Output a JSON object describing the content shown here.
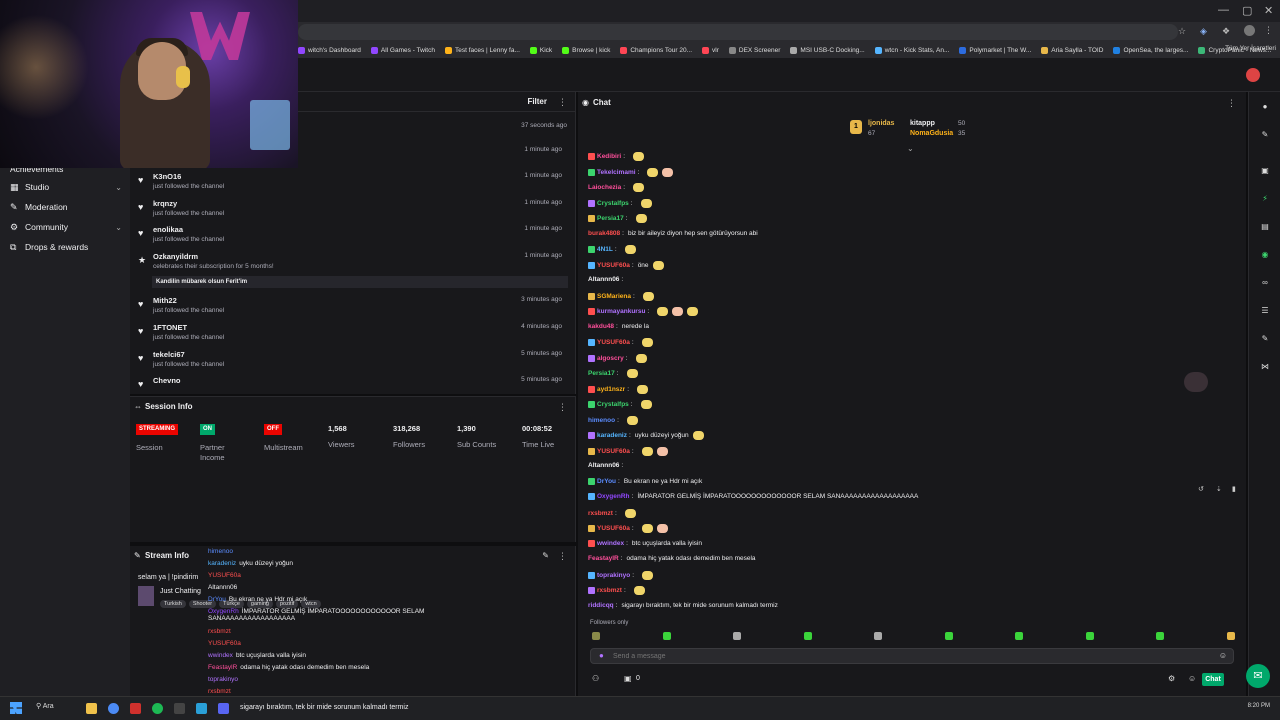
{
  "browser": {
    "bookmarks": [
      "witch's Dashboard",
      "All Games - Twitch",
      "Test faces | Lenny fa...",
      "Kick",
      "Browse | kick",
      "Champions Tour 20...",
      "vlr",
      "DEX Screener",
      "MSI USB-C Docking...",
      "wtcn - Kick Stats, An...",
      "Polymarket | The W...",
      "Aria Saylla - TOID",
      "OpenSea, the larges...",
      "CryptoPanic - News..."
    ],
    "bookmarks_end": "Tüm Yer İşaretleri"
  },
  "sidebar": {
    "items": [
      {
        "label": "Achievements"
      },
      {
        "label": "Studio"
      },
      {
        "label": "Moderation"
      },
      {
        "label": "Community"
      },
      {
        "label": "Drops & rewards"
      }
    ]
  },
  "activity": {
    "filter_label": "Filter",
    "first_time": "37 seconds ago",
    "rows": [
      {
        "name": "",
        "sub": "",
        "time": "1 minute ago"
      },
      {
        "name": "K3nO16",
        "sub": "just followed the channel",
        "time": "1 minute ago"
      },
      {
        "name": "krqnzy",
        "sub": "just followed the channel",
        "time": "1 minute ago"
      },
      {
        "name": "enolikaa",
        "sub": "just followed the channel",
        "time": "1 minute ago"
      },
      {
        "name": "Ozkanyildrm",
        "sub": "celebrates their subscription for 5 months!",
        "time": "1 minute ago",
        "message": "Kandilin mübarek olsun Ferit'im"
      },
      {
        "name": "Mith22",
        "sub": "just followed the channel",
        "time": "3 minutes ago"
      },
      {
        "name": "1FTONET",
        "sub": "just followed the channel",
        "time": "4 minutes ago"
      },
      {
        "name": "tekelci67",
        "sub": "just followed the channel",
        "time": "5 minutes ago"
      },
      {
        "name": "Chevno",
        "sub": "",
        "time": "5 minutes ago"
      }
    ]
  },
  "session": {
    "title": "Session Info",
    "badges": [
      {
        "label": "STREAMING",
        "color": "#eb0400",
        "caption": "Session"
      },
      {
        "label": "ON",
        "color": "#00a86b",
        "caption": "Partner Income"
      },
      {
        "label": "OFF",
        "color": "#eb0400",
        "caption": "Multistream"
      }
    ],
    "stats": [
      {
        "value": "1,568",
        "label": "Viewers"
      },
      {
        "value": "318,268",
        "label": "Followers"
      },
      {
        "value": "1,390",
        "label": "Sub Counts"
      },
      {
        "value": "00:08:52",
        "label": "Time Live"
      }
    ]
  },
  "stream_info": {
    "title": "Stream Info",
    "stream_title": "selam ya | !pindirim",
    "category": "Just Chatting",
    "tags": [
      "Turkish",
      "Shooter",
      "Türkçe",
      "gaming",
      "pozitif",
      "wtcn"
    ],
    "mini_chat": [
      {
        "user": "himenoo",
        "text": "",
        "color": "#5b8cff"
      },
      {
        "user": "karadeniz",
        "text": "uyku düzeyi yoğun",
        "color": "#55b5ff"
      },
      {
        "user": "YUSUF60a",
        "text": "",
        "color": "#ff4f4f"
      },
      {
        "user": "Altannn06",
        "text": "",
        "color": "#efeff1"
      },
      {
        "user": "DrYou",
        "text": "Bu ekran ne ya Hdr mi açık",
        "color": "#5b8cff"
      },
      {
        "user": "OxygenRh",
        "text": "İMPARATOR GELMİŞ İMPARATOOOOOOOOOOOOR SELAM SANAAAAAAAAAAAAAAAAA",
        "color": "#9147ff"
      },
      {
        "user": "rxsbmzt",
        "text": "",
        "color": "#ff4f4f"
      },
      {
        "user": "YUSUF60a",
        "text": "",
        "color": "#ff4f4f"
      },
      {
        "user": "wwindex",
        "text": "btc uçuşlarda valla iyisin",
        "color": "#b072ff"
      },
      {
        "user": "FeastaylR",
        "text": "odama hiç yatak odası demedim ben mesela",
        "color": "#ff4f9b"
      },
      {
        "user": "toprakinyo",
        "text": "",
        "color": "#b072ff"
      },
      {
        "user": "rxsbmzt",
        "text": "",
        "color": "#ff4f4f"
      }
    ]
  },
  "chat": {
    "title": "Chat",
    "leaderboard": [
      {
        "rank": "1",
        "user": "ljonidas",
        "score": "67"
      },
      {
        "user": "kitappp",
        "score": "50"
      },
      {
        "user": "NomaGdusia",
        "score": "35"
      }
    ],
    "messages": [
      {
        "user": "Kedibiri",
        "text": "",
        "color": "#ff4f9b",
        "emotes": 1
      },
      {
        "user": "Tekelcimami",
        "text": "",
        "color": "#b072ff",
        "emotes": 2
      },
      {
        "user": "Laiochezia",
        "text": "",
        "color": "#ff4f9b",
        "emotes": 1
      },
      {
        "user": "Crystalfps",
        "text": "",
        "color": "#3cd46e",
        "emotes": 1
      },
      {
        "user": "Persia17",
        "text": "",
        "color": "#3cd46e",
        "emotes": 1
      },
      {
        "user": "burak4808",
        "text": "biz bir aileyiz diyon hep sen götürüyorsun abi",
        "color": "#ff4f4f",
        "emotes": 0
      },
      {
        "user": "4N1L",
        "text": "",
        "color": "#55b5ff",
        "emotes": 1
      },
      {
        "user": "YUSUF60a",
        "text": "öne",
        "color": "#ff4f4f",
        "emotes": 1
      },
      {
        "user": "Altannn06",
        "text": "",
        "color": "#efeff1",
        "emotes": 0
      },
      {
        "user": "SGMariena",
        "text": "",
        "color": "#ffb31a",
        "emotes": 1
      },
      {
        "user": "kurmayankursu",
        "text": "",
        "color": "#b072ff",
        "emotes": 3
      },
      {
        "user": "kakdu48",
        "text": "nerede la",
        "color": "#ff4f9b",
        "emotes": 0
      },
      {
        "user": "YUSUF60a",
        "text": "",
        "color": "#ff4f4f",
        "emotes": 1
      },
      {
        "user": "algoscry",
        "text": "",
        "color": "#ff4f9b",
        "emotes": 1
      },
      {
        "user": "Persia17",
        "text": "",
        "color": "#3cd46e",
        "emotes": 1
      },
      {
        "user": "ayd1nszr",
        "text": "",
        "color": "#ffb31a",
        "emotes": 1
      },
      {
        "user": "Crystalfps",
        "text": "",
        "color": "#3cd46e",
        "emotes": 1
      },
      {
        "user": "himenoo",
        "text": "",
        "color": "#5b8cff",
        "emotes": 1
      },
      {
        "user": "karadeniz",
        "text": "uyku düzeyi yoğun",
        "color": "#55b5ff",
        "emotes": 1
      },
      {
        "user": "YUSUF60a",
        "text": "",
        "color": "#ff4f4f",
        "emotes": 2
      },
      {
        "user": "Altannn06",
        "text": "",
        "color": "#efeff1",
        "emotes": 0
      },
      {
        "user": "DrYou",
        "text": "Bu ekran ne ya Hdr mi açık",
        "color": "#5b8cff",
        "emotes": 0
      },
      {
        "user": "OxygenRh",
        "text": "İMPARATOR GELMİŞ İMPARATOOOOOOOOOOOOOR SELAM SANAAAAAAAAAAAAAAAAAA",
        "color": "#9147ff",
        "emotes": 0
      },
      {
        "user": "rxsbmzt",
        "text": "",
        "color": "#ff4f4f",
        "emotes": 1
      },
      {
        "user": "YUSUF60a",
        "text": "",
        "color": "#ff4f4f",
        "emotes": 2
      },
      {
        "user": "wwindex",
        "text": "btc uçuşlarda valla iyisin",
        "color": "#b072ff",
        "emotes": 0
      },
      {
        "user": "FeastaylR",
        "text": "odama hiç yatak odası demedim ben mesela",
        "color": "#ff4f9b",
        "emotes": 0
      },
      {
        "user": "toprakinyo",
        "text": "",
        "color": "#b072ff",
        "emotes": 1
      },
      {
        "user": "rxsbmzt",
        "text": "",
        "color": "#ff4f4f",
        "emotes": 1
      },
      {
        "user": "riddicqq",
        "text": "sigarayı bıraktım, tek bir mide sorunum kalmadı termiz",
        "color": "#b072ff",
        "emotes": 0
      }
    ],
    "followers_only": "Followers only",
    "input_placeholder": "Send a message",
    "points": "0",
    "chat_button": "Chat"
  },
  "taskbar": {
    "search_label": "Ara",
    "last_message": "sigarayı bıraktım, tek bir mide sorunum kalmadı termiz",
    "clock": "8:20 PM"
  }
}
